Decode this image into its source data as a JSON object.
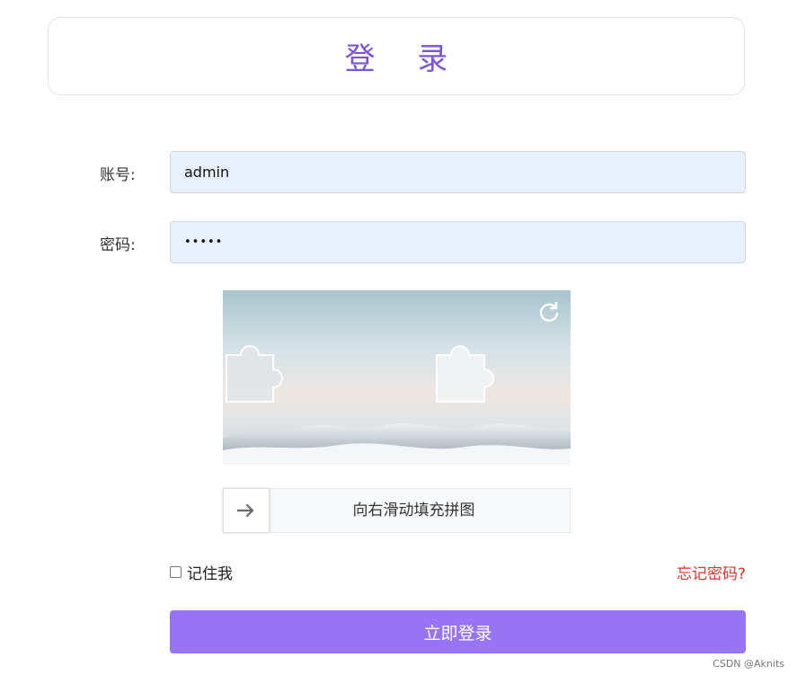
{
  "header": {
    "title": "登 录"
  },
  "form": {
    "account_label": "账号:",
    "account_value": "admin",
    "password_label": "密码:",
    "password_value": "•••••"
  },
  "captcha": {
    "refresh_icon": "refresh-icon",
    "slider_text": "向右滑动填充拼图",
    "slider_icon": "arrow-right-icon"
  },
  "options": {
    "remember_label": "记住我",
    "remember_checked": false,
    "forgot_label": "忘记密码?"
  },
  "actions": {
    "login_label": "立即登录"
  },
  "footer": {
    "watermark": "CSDN @Aknits"
  },
  "colors": {
    "accent": "#9674f3",
    "title": "#7b55d6",
    "danger": "#e0352b",
    "field_bg": "#e8f0fe"
  }
}
